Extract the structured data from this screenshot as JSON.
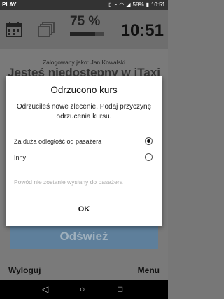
{
  "statusbar": {
    "left_text": "PLAY",
    "battery": "58%",
    "time": "10:51"
  },
  "toolbar": {
    "percent": "75 %",
    "progress_fraction": 0.75,
    "clock": "10:51"
  },
  "main": {
    "logged_in": "Zalogowany jako: Jan Kowalski",
    "status": "Jesteś niedostępny w iTaxi",
    "refresh_label": "Odśwież"
  },
  "dialog": {
    "title": "Odrzucono kurs",
    "message": "Odrzuciłeś nowe zlecenie. Podaj przyczynę odrzucenia kursu.",
    "options": [
      {
        "label": "Za duża odległość od pasażera",
        "selected": true
      },
      {
        "label": "Inny",
        "selected": false
      }
    ],
    "note": "Powód nie zostanie wysłany do pasażera",
    "ok_label": "OK"
  },
  "appbar": {
    "logout_label": "Wyloguj",
    "menu_label": "Menu"
  },
  "colors": {
    "refresh": "#5e7f9b"
  }
}
